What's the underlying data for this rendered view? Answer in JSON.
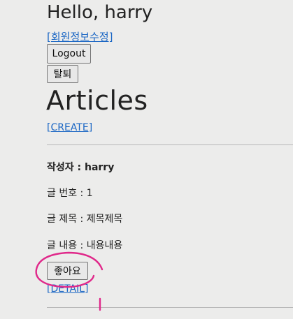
{
  "header": {
    "greeting": "Hello, harry",
    "edit_profile_link": "[회원정보수정]",
    "logout_button": "Logout",
    "withdraw_button": "탈퇴"
  },
  "main": {
    "title": "Articles",
    "create_link": "[CREATE]",
    "articles": [
      {
        "author_line": "작성자 : harry",
        "number_line": "글 번호 : 1",
        "title_line": "글 제목 : 제목제목",
        "content_line": "글 내용 : 내용내용",
        "like_button": "좋아요",
        "detail_link": "[DETAIL]"
      }
    ]
  },
  "annotation": {
    "color": "#e0288a"
  }
}
